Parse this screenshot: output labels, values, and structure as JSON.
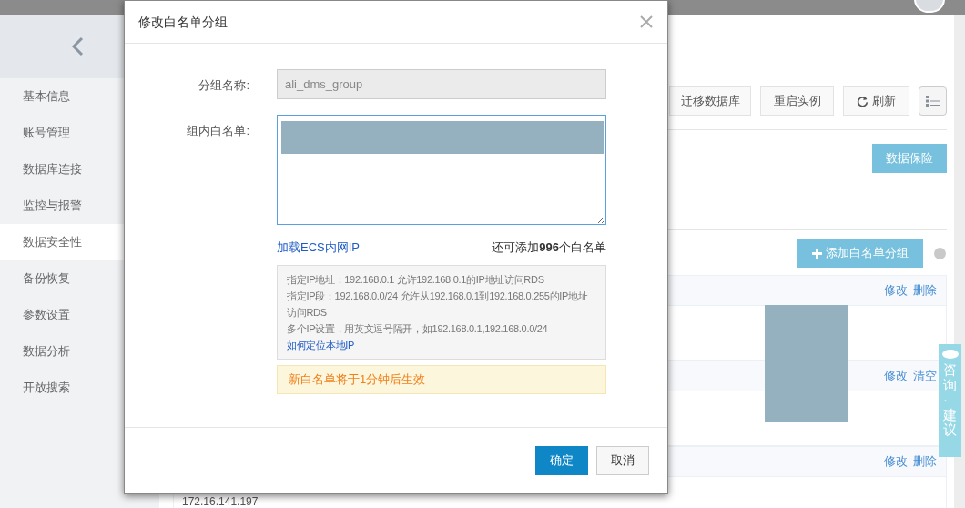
{
  "sidebar": {
    "items": [
      {
        "label": "基本信息",
        "selected": false
      },
      {
        "label": "账号管理",
        "selected": false
      },
      {
        "label": "数据库连接",
        "selected": false
      },
      {
        "label": "监控与报警",
        "selected": false
      },
      {
        "label": "数据安全性",
        "selected": true
      },
      {
        "label": "备份恢复",
        "selected": false
      },
      {
        "label": "参数设置",
        "selected": false
      },
      {
        "label": "数据分析",
        "selected": false
      },
      {
        "label": "开放搜索",
        "selected": false
      }
    ]
  },
  "toolbar": {
    "buttons": [
      {
        "label": "迁移数据库",
        "kind": "text"
      },
      {
        "label": "重启实例",
        "kind": "text"
      },
      {
        "label": "刷新",
        "kind": "refresh"
      },
      {
        "kind": "list"
      }
    ]
  },
  "insurance_button": "数据保险",
  "whitelist": {
    "add_button": "添加白名单分组",
    "groups": [
      {
        "actions": [
          "修改",
          "删除"
        ]
      },
      {
        "actions": [
          "修改",
          "清空"
        ]
      },
      {
        "actions": [
          "修改",
          "删除"
        ]
      }
    ],
    "visible_ip": "172.16.141.197"
  },
  "feedback_tab": "咨询·建议",
  "dialog": {
    "title": "修改白名单分组",
    "fields": [
      {
        "label": "分组名称:",
        "value": "ali_dms_group",
        "disabled": true
      },
      {
        "label": "组内白名单:"
      }
    ],
    "load_link": "加载ECS内网IP",
    "remaining": "还可添加**996**个白名单",
    "hints": [
      "指定IP地址：192.168.0.1 允许192.168.0.1的IP地址访问RDS",
      "指定IP段：192.168.0.0/24 允许从192.168.0.1到192.168.0.255的IP地址访问RDS",
      "多个IP设置，用英文逗号隔开，如192.168.0.1,192.168.0.0/24"
    ],
    "help_link": "如何定位本地IP",
    "notice": "新白名单将于1分钟后生效",
    "buttons": [
      {
        "label": "确定",
        "kind": "primary"
      },
      {
        "label": "取消",
        "kind": "default"
      }
    ]
  }
}
